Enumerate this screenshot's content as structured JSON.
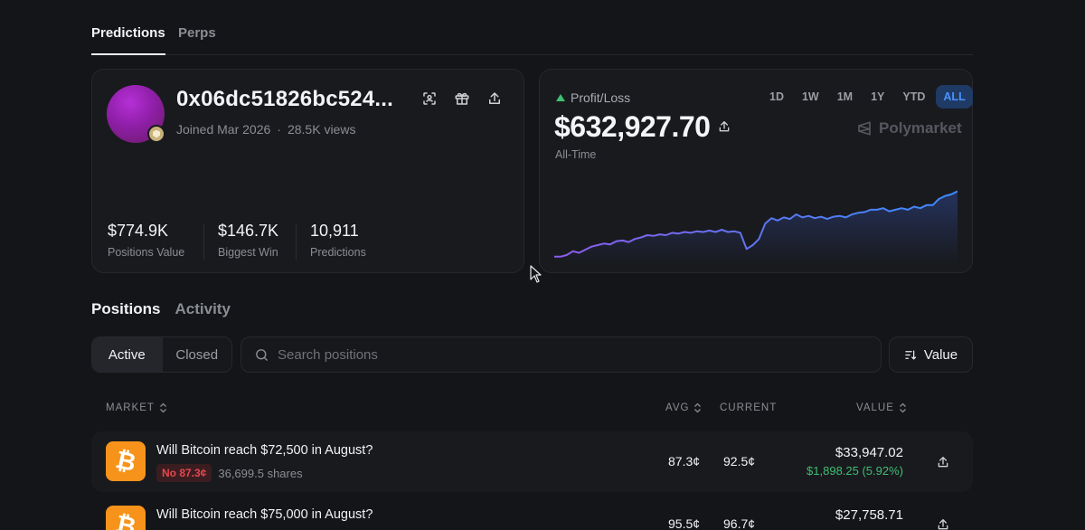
{
  "top_tabs": [
    {
      "label": "Predictions",
      "active": true
    },
    {
      "label": "Perps",
      "active": false
    }
  ],
  "profile": {
    "address": "0x06dc51826bc524...",
    "joined": "Joined Mar 2026",
    "views": "28.5K views",
    "stats": [
      {
        "value": "$774.9K",
        "label": "Positions Value"
      },
      {
        "value": "$146.7K",
        "label": "Biggest Win"
      },
      {
        "value": "10,911",
        "label": "Predictions"
      }
    ],
    "icons": [
      "scan-icon",
      "gift-icon",
      "share-icon"
    ]
  },
  "pnl": {
    "label": "Profit/Loss",
    "amount": "$632,927.70",
    "period": "All-Time",
    "ranges": [
      "1D",
      "1W",
      "1M",
      "1Y",
      "YTD",
      "ALL"
    ],
    "active_range": "ALL",
    "brand": "Polymarket",
    "trend_color": "#3fbf72",
    "accent_color": "#4b92ff",
    "sparkline": [
      0.05,
      0.05,
      0.07,
      0.12,
      0.1,
      0.14,
      0.18,
      0.2,
      0.22,
      0.21,
      0.25,
      0.26,
      0.24,
      0.28,
      0.3,
      0.33,
      0.32,
      0.34,
      0.33,
      0.36,
      0.35,
      0.37,
      0.36,
      0.38,
      0.37,
      0.39,
      0.37,
      0.4,
      0.37,
      0.38,
      0.36,
      0.15,
      0.2,
      0.28,
      0.48,
      0.55,
      0.52,
      0.56,
      0.54,
      0.6,
      0.56,
      0.58,
      0.55,
      0.57,
      0.54,
      0.57,
      0.58,
      0.56,
      0.6,
      0.62,
      0.63,
      0.66,
      0.66,
      0.68,
      0.64,
      0.66,
      0.68,
      0.66,
      0.7,
      0.68,
      0.72,
      0.72,
      0.8,
      0.84,
      0.86,
      0.9
    ]
  },
  "positions": {
    "tabs": [
      {
        "label": "Positions",
        "active": true
      },
      {
        "label": "Activity",
        "active": false
      }
    ],
    "filter": [
      {
        "label": "Active",
        "active": true
      },
      {
        "label": "Closed",
        "active": false
      }
    ],
    "search_placeholder": "Search positions",
    "sort_label": "Value",
    "headers": {
      "market": "MARKET",
      "avg": "AVG",
      "current": "CURRENT",
      "value": "VALUE"
    },
    "rows": [
      {
        "title": "Will Bitcoin reach $72,500 in August?",
        "outcome": "No 87.3¢",
        "shares": "36,699.5 shares",
        "avg": "87.3¢",
        "current": "92.5¢",
        "value": "$33,947.02",
        "pnl": "$1,898.25 (5.92%)",
        "icon": "bitcoin-icon"
      },
      {
        "title": "Will Bitcoin reach $75,000 in August?",
        "outcome": "",
        "shares": "",
        "avg": "95.5¢",
        "current": "96.7¢",
        "value": "$27,758.71",
        "pnl": "",
        "icon": "bitcoin-icon"
      }
    ]
  }
}
